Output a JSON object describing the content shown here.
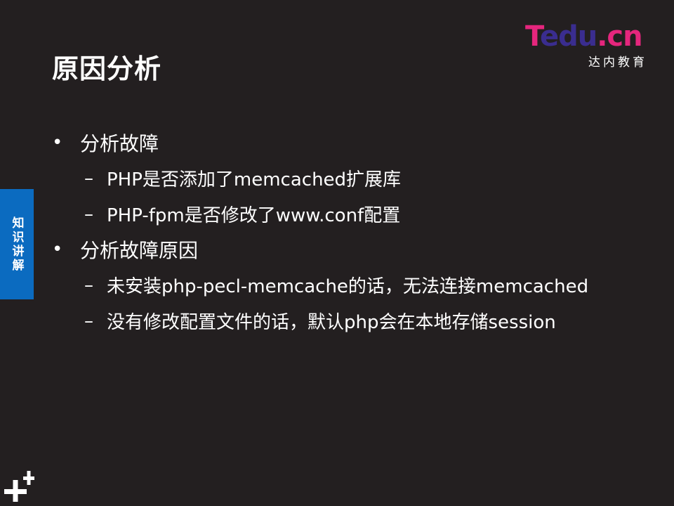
{
  "title": "原因分析",
  "logo": {
    "brand_part1": "T",
    "brand_part2": "edu",
    "brand_part3": ".cn",
    "subtitle": "达内教育"
  },
  "side_tab": {
    "label": "知识讲解"
  },
  "sections": [
    {
      "bullet": "•",
      "text": "分析故障",
      "items": [
        {
          "dash": "–",
          "text": "PHP是否添加了memcached扩展库"
        },
        {
          "dash": "–",
          "text": "PHP-fpm是否修改了www.conf配置"
        }
      ]
    },
    {
      "bullet": "•",
      "text": "分析故障原因",
      "items": [
        {
          "dash": "–",
          "text": "未安装php-pecl-memcache的话，无法连接memcached"
        },
        {
          "dash": "–",
          "text": "没有修改配置文件的话，默认php会在本地存储session"
        }
      ]
    }
  ],
  "colors": {
    "background": "#231f20",
    "side_tab": "#0b6bc0",
    "logo_pink": "#e5267d",
    "logo_purple": "#3a2d8f"
  },
  "icons": {
    "corner": "plus-plus-icon"
  }
}
